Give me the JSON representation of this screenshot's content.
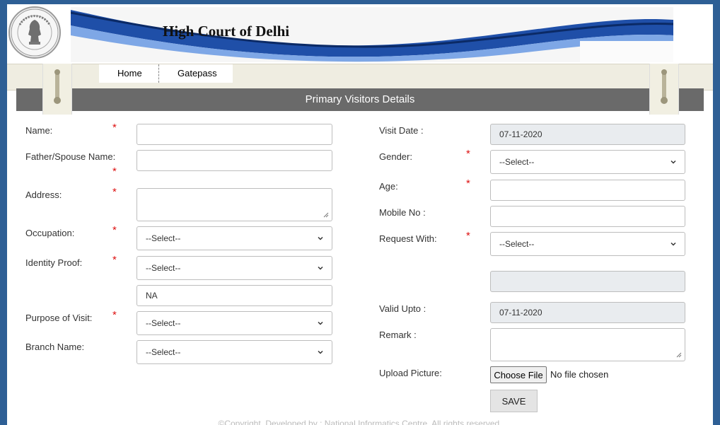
{
  "header": {
    "banner_title": "High Court of Delhi"
  },
  "nav": {
    "items": [
      {
        "label": "Home"
      },
      {
        "label": "Gatepass"
      }
    ]
  },
  "section_title": "Primary Visitors Details",
  "form_left": {
    "name_label": "Name:",
    "father_label": "Father/Spouse Name:",
    "address_label": "Address:",
    "occupation_label": "Occupation:",
    "occupation_value": "--Select--",
    "identity_label": "Identity Proof:",
    "identity_value": "--Select--",
    "identity_number_value": "NA",
    "purpose_label": "Purpose of Visit:",
    "purpose_value": "--Select--",
    "branch_label": "Branch Name:",
    "branch_value": "--Select--",
    "required_mark": "*"
  },
  "form_right": {
    "visit_date_label": "Visit Date :",
    "visit_date_value": "07-11-2020",
    "gender_label": "Gender:",
    "gender_value": "--Select--",
    "age_label": "Age:",
    "mobile_label": "Mobile No :",
    "request_label": "Request With:",
    "request_value": "--Select--",
    "valid_label": "Valid Upto :",
    "valid_value": "07-11-2020",
    "remark_label": "Remark :",
    "upload_label": "Upload Picture:",
    "choose_file_label": "Choose File",
    "no_file_text": "No file chosen",
    "save_label": "SAVE"
  },
  "footer": {
    "text": "©Copyright, Developed by : National Informatics Centre. All rights reserved."
  },
  "colors": {
    "outer_frame": "#2e5f95",
    "title_bar": "#6a6a6a",
    "menu_bar": "#efede1",
    "required": "#dd1111",
    "banner_blue": "#1a5dc8"
  }
}
